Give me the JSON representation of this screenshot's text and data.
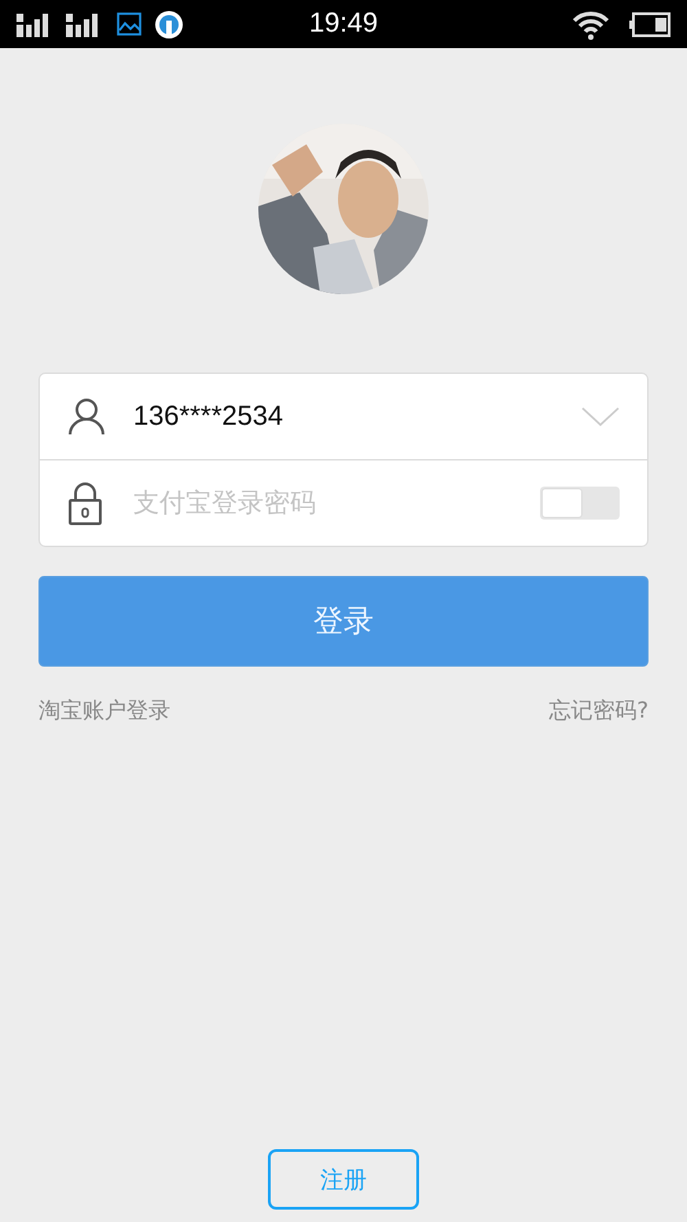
{
  "status_bar": {
    "time": "19:49"
  },
  "account_field": {
    "value": "136****2534"
  },
  "password_field": {
    "placeholder": "支付宝登录密码",
    "show_password": {
      "on": false
    }
  },
  "login_button": {
    "label": "登录",
    "disabled": true
  },
  "links": [
    "淘宝账户登录",
    "忘记密码?"
  ],
  "register_button": {
    "label": "注册"
  }
}
